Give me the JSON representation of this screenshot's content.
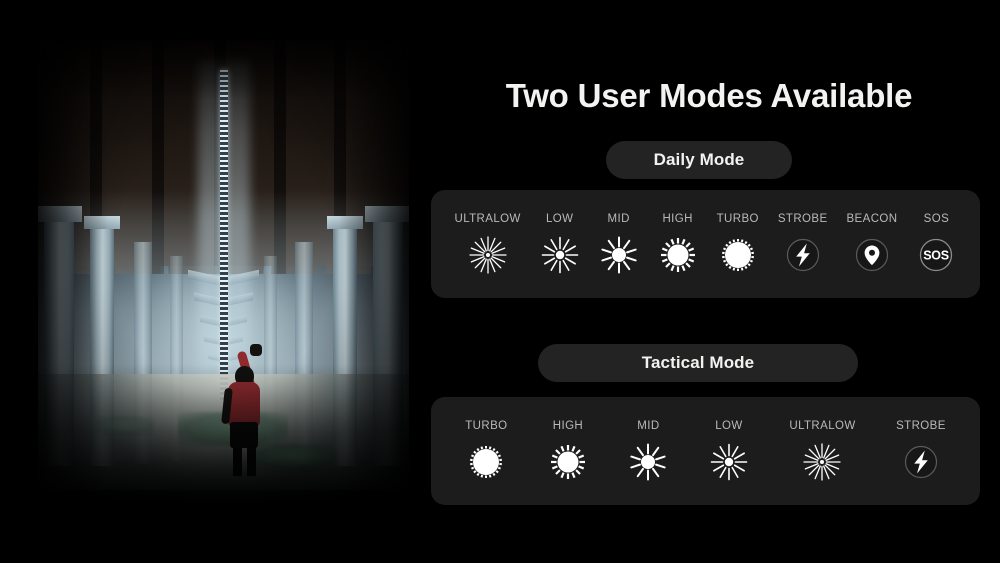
{
  "heading": "Two User Modes Available",
  "photo": {
    "alt_description": "Person in red shirt raising a flashlight under a concrete highway overpass at night",
    "subject": "flashlight-beam-under-bridge"
  },
  "daily": {
    "pill_label": "Daily Mode",
    "modes": [
      {
        "label": "ULTRALOW",
        "icon": "sunburst-ultralow-icon"
      },
      {
        "label": "LOW",
        "icon": "sunburst-low-icon"
      },
      {
        "label": "MID",
        "icon": "sunburst-mid-icon"
      },
      {
        "label": "HIGH",
        "icon": "sunburst-high-icon"
      },
      {
        "label": "TURBO",
        "icon": "sunburst-turbo-icon"
      },
      {
        "label": "STROBE",
        "icon": "lightning-bolt-icon"
      },
      {
        "label": "BEACON",
        "icon": "location-pin-icon"
      },
      {
        "label": "SOS",
        "icon": "sos-icon"
      }
    ]
  },
  "tactical": {
    "pill_label": "Tactical Mode",
    "modes": [
      {
        "label": "TURBO",
        "icon": "sunburst-turbo-icon"
      },
      {
        "label": "HIGH",
        "icon": "sunburst-high-icon"
      },
      {
        "label": "MID",
        "icon": "sunburst-mid-icon"
      },
      {
        "label": "LOW",
        "icon": "sunburst-low-icon"
      },
      {
        "label": "ULTRALOW",
        "icon": "sunburst-ultralow-icon"
      },
      {
        "label": "STROBE",
        "icon": "lightning-bolt-icon"
      }
    ]
  },
  "sos_text": "SOS",
  "colors": {
    "background": "#000000",
    "card": "#1c1c1c",
    "pill": "#232323",
    "title_text": "#f3f3f1",
    "label_text": "#b9b9b7",
    "icon": "#ffffff",
    "shirt": "#8f2b2f"
  }
}
